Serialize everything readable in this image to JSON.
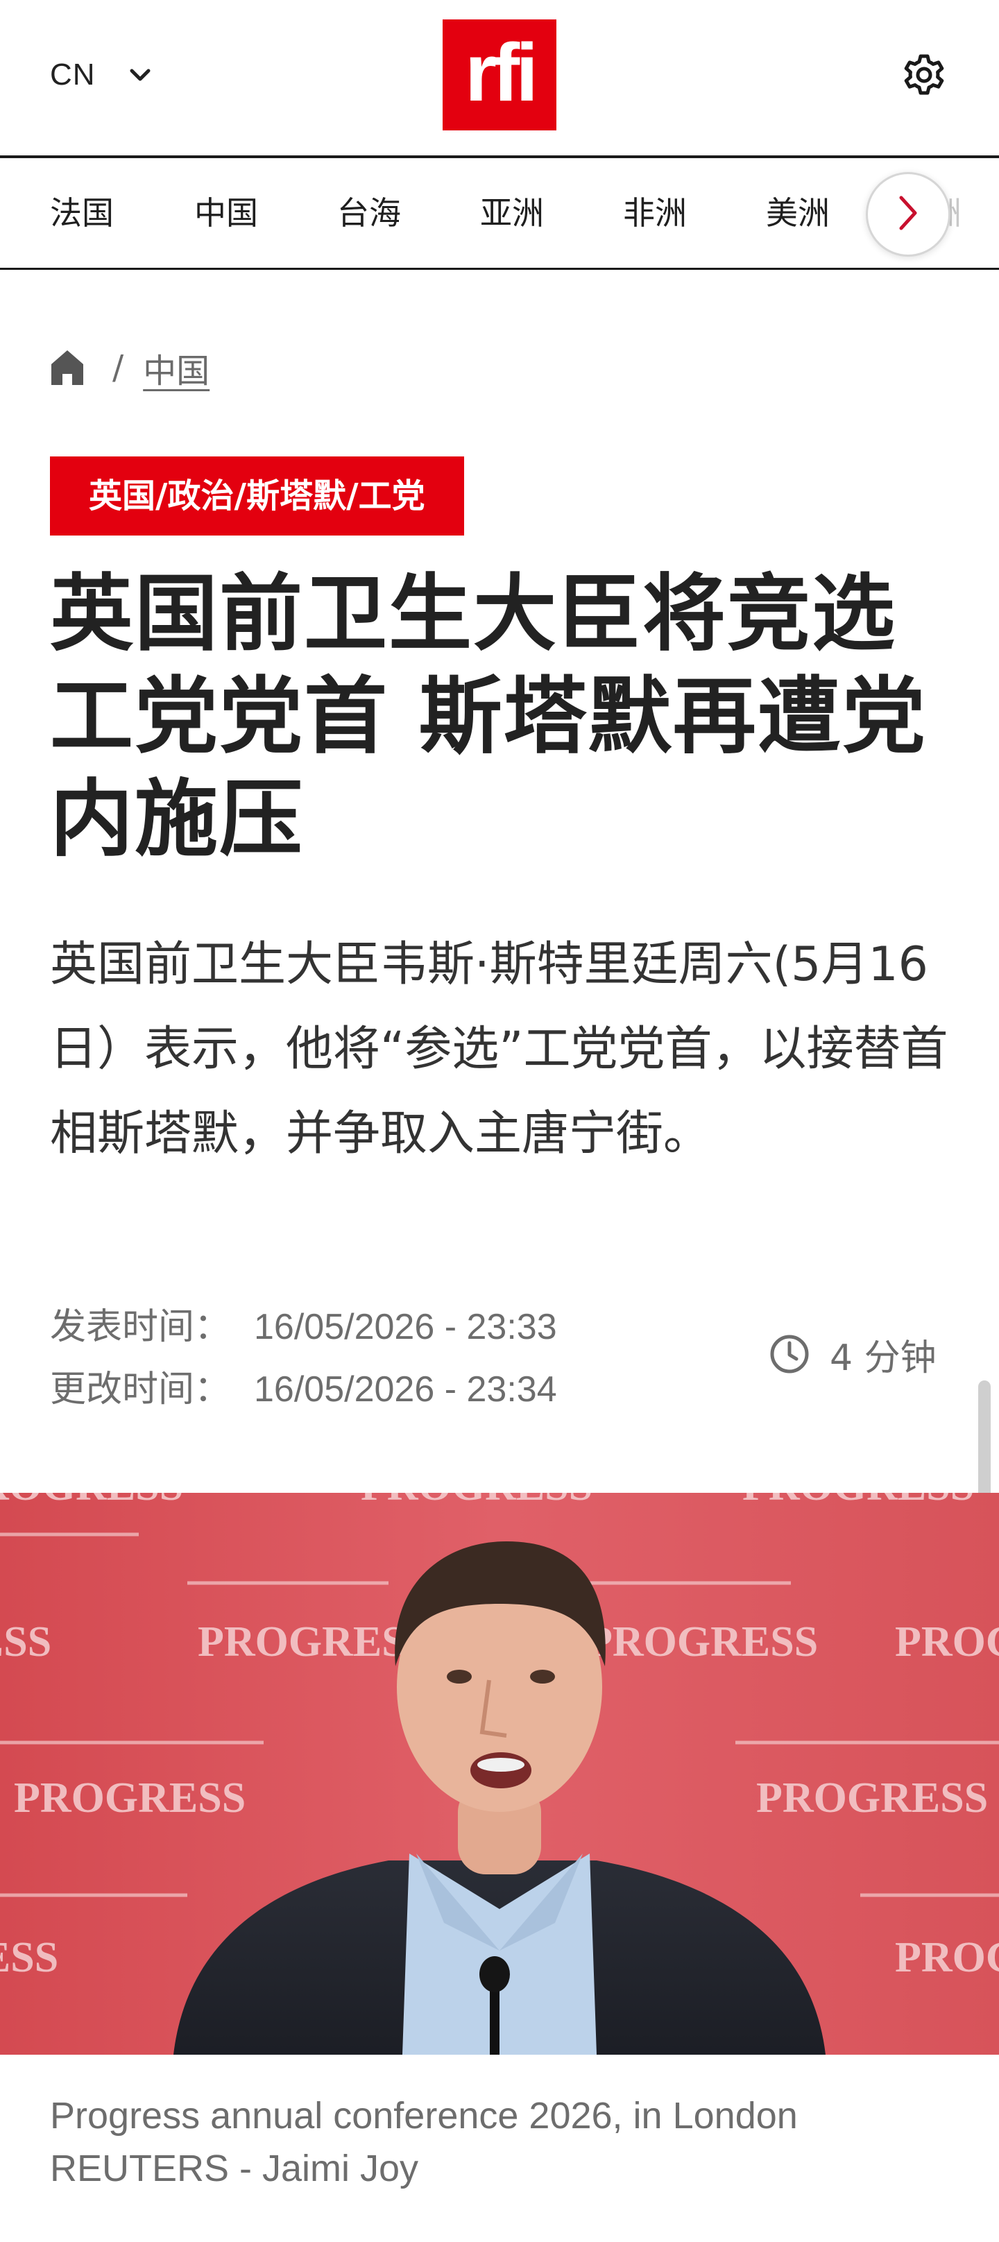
{
  "header": {
    "language": "CN",
    "logo_text": "rfi",
    "brand_color": "#e3000f"
  },
  "nav": {
    "items": [
      "法国",
      "中国",
      "台海",
      "亚洲",
      "非洲",
      "美洲"
    ],
    "overflow_item": "洲"
  },
  "breadcrumb": {
    "separator": "/",
    "current": "中国"
  },
  "article": {
    "tag": "英国/政治/斯塔默/工党",
    "headline": "英国前卫生大臣将竞选工党党首 斯塔默再遭党内施压",
    "lede": "英国前卫生大臣韦斯·斯特里廷周六(5月16日）表示，他将“参选”工党党首，以接替首相斯塔默，并争取入主唐宁街。",
    "published_label": "发表时间：",
    "published_value": "16/05/2026 - 23:33",
    "updated_label": "更改时间：",
    "updated_value": "16/05/2026 - 23:34",
    "read_time": "4 分钟"
  },
  "photo": {
    "backdrop_text": "PROGRESS",
    "backdrop_color": "#d9545a",
    "caption_line1": "Progress annual conference 2026, in London",
    "caption_line2": "REUTERS - Jaimi Joy"
  },
  "icons": {
    "language": "chevron-down-icon",
    "settings": "gear-icon",
    "nav_next": "chevron-right-icon",
    "home": "home-icon",
    "read_time": "clock-icon"
  }
}
